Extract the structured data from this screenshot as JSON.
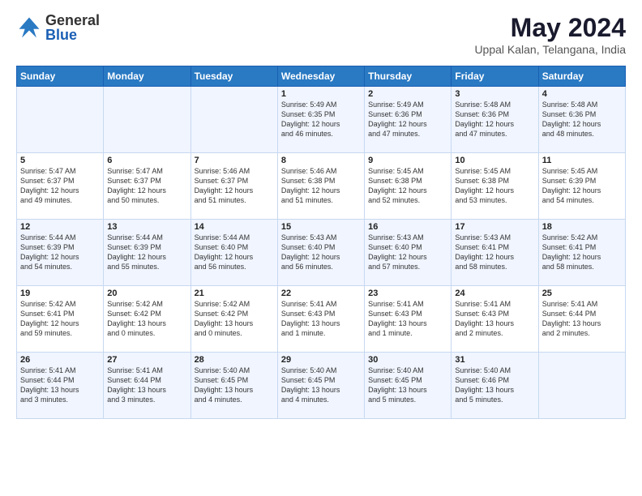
{
  "header": {
    "logo_general": "General",
    "logo_blue": "Blue",
    "month_title": "May 2024",
    "location": "Uppal Kalan, Telangana, India"
  },
  "days_of_week": [
    "Sunday",
    "Monday",
    "Tuesday",
    "Wednesday",
    "Thursday",
    "Friday",
    "Saturday"
  ],
  "weeks": [
    [
      {
        "day": "",
        "info": ""
      },
      {
        "day": "",
        "info": ""
      },
      {
        "day": "",
        "info": ""
      },
      {
        "day": "1",
        "info": "Sunrise: 5:49 AM\nSunset: 6:35 PM\nDaylight: 12 hours\nand 46 minutes."
      },
      {
        "day": "2",
        "info": "Sunrise: 5:49 AM\nSunset: 6:36 PM\nDaylight: 12 hours\nand 47 minutes."
      },
      {
        "day": "3",
        "info": "Sunrise: 5:48 AM\nSunset: 6:36 PM\nDaylight: 12 hours\nand 47 minutes."
      },
      {
        "day": "4",
        "info": "Sunrise: 5:48 AM\nSunset: 6:36 PM\nDaylight: 12 hours\nand 48 minutes."
      }
    ],
    [
      {
        "day": "5",
        "info": "Sunrise: 5:47 AM\nSunset: 6:37 PM\nDaylight: 12 hours\nand 49 minutes."
      },
      {
        "day": "6",
        "info": "Sunrise: 5:47 AM\nSunset: 6:37 PM\nDaylight: 12 hours\nand 50 minutes."
      },
      {
        "day": "7",
        "info": "Sunrise: 5:46 AM\nSunset: 6:37 PM\nDaylight: 12 hours\nand 51 minutes."
      },
      {
        "day": "8",
        "info": "Sunrise: 5:46 AM\nSunset: 6:38 PM\nDaylight: 12 hours\nand 51 minutes."
      },
      {
        "day": "9",
        "info": "Sunrise: 5:45 AM\nSunset: 6:38 PM\nDaylight: 12 hours\nand 52 minutes."
      },
      {
        "day": "10",
        "info": "Sunrise: 5:45 AM\nSunset: 6:38 PM\nDaylight: 12 hours\nand 53 minutes."
      },
      {
        "day": "11",
        "info": "Sunrise: 5:45 AM\nSunset: 6:39 PM\nDaylight: 12 hours\nand 54 minutes."
      }
    ],
    [
      {
        "day": "12",
        "info": "Sunrise: 5:44 AM\nSunset: 6:39 PM\nDaylight: 12 hours\nand 54 minutes."
      },
      {
        "day": "13",
        "info": "Sunrise: 5:44 AM\nSunset: 6:39 PM\nDaylight: 12 hours\nand 55 minutes."
      },
      {
        "day": "14",
        "info": "Sunrise: 5:44 AM\nSunset: 6:40 PM\nDaylight: 12 hours\nand 56 minutes."
      },
      {
        "day": "15",
        "info": "Sunrise: 5:43 AM\nSunset: 6:40 PM\nDaylight: 12 hours\nand 56 minutes."
      },
      {
        "day": "16",
        "info": "Sunrise: 5:43 AM\nSunset: 6:40 PM\nDaylight: 12 hours\nand 57 minutes."
      },
      {
        "day": "17",
        "info": "Sunrise: 5:43 AM\nSunset: 6:41 PM\nDaylight: 12 hours\nand 58 minutes."
      },
      {
        "day": "18",
        "info": "Sunrise: 5:42 AM\nSunset: 6:41 PM\nDaylight: 12 hours\nand 58 minutes."
      }
    ],
    [
      {
        "day": "19",
        "info": "Sunrise: 5:42 AM\nSunset: 6:41 PM\nDaylight: 12 hours\nand 59 minutes."
      },
      {
        "day": "20",
        "info": "Sunrise: 5:42 AM\nSunset: 6:42 PM\nDaylight: 13 hours\nand 0 minutes."
      },
      {
        "day": "21",
        "info": "Sunrise: 5:42 AM\nSunset: 6:42 PM\nDaylight: 13 hours\nand 0 minutes."
      },
      {
        "day": "22",
        "info": "Sunrise: 5:41 AM\nSunset: 6:43 PM\nDaylight: 13 hours\nand 1 minute."
      },
      {
        "day": "23",
        "info": "Sunrise: 5:41 AM\nSunset: 6:43 PM\nDaylight: 13 hours\nand 1 minute."
      },
      {
        "day": "24",
        "info": "Sunrise: 5:41 AM\nSunset: 6:43 PM\nDaylight: 13 hours\nand 2 minutes."
      },
      {
        "day": "25",
        "info": "Sunrise: 5:41 AM\nSunset: 6:44 PM\nDaylight: 13 hours\nand 2 minutes."
      }
    ],
    [
      {
        "day": "26",
        "info": "Sunrise: 5:41 AM\nSunset: 6:44 PM\nDaylight: 13 hours\nand 3 minutes."
      },
      {
        "day": "27",
        "info": "Sunrise: 5:41 AM\nSunset: 6:44 PM\nDaylight: 13 hours\nand 3 minutes."
      },
      {
        "day": "28",
        "info": "Sunrise: 5:40 AM\nSunset: 6:45 PM\nDaylight: 13 hours\nand 4 minutes."
      },
      {
        "day": "29",
        "info": "Sunrise: 5:40 AM\nSunset: 6:45 PM\nDaylight: 13 hours\nand 4 minutes."
      },
      {
        "day": "30",
        "info": "Sunrise: 5:40 AM\nSunset: 6:45 PM\nDaylight: 13 hours\nand 5 minutes."
      },
      {
        "day": "31",
        "info": "Sunrise: 5:40 AM\nSunset: 6:46 PM\nDaylight: 13 hours\nand 5 minutes."
      },
      {
        "day": "",
        "info": ""
      }
    ]
  ]
}
